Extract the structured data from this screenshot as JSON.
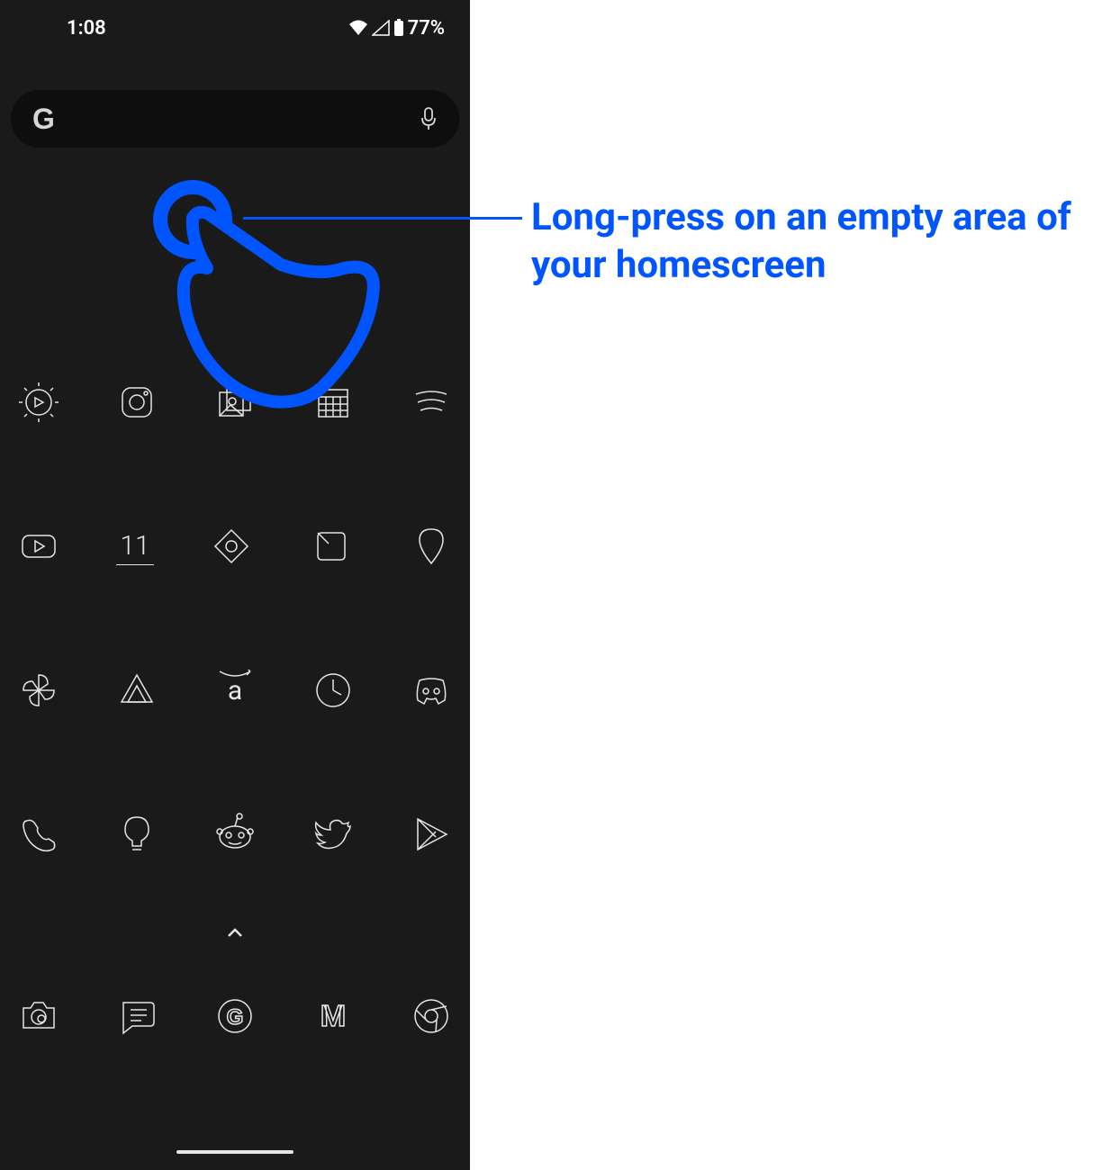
{
  "statusbar": {
    "time": "1:08",
    "battery": "77%"
  },
  "search": {
    "logo": "G"
  },
  "rows": [
    [
      "youtube-studio-icon",
      "instagram-icon",
      "gallery-icon",
      "calendar-icon",
      "spotify-icon"
    ],
    [
      "youtube-icon",
      "eleven-icon",
      "diamond-icon",
      "file-icon",
      "location-icon"
    ],
    [
      "photos-icon",
      "drive-icon",
      "amazon-icon",
      "clock-icon",
      "discord-icon"
    ],
    [
      "phone-icon",
      "keep-icon",
      "reddit-icon",
      "twitter-icon",
      "play-store-icon"
    ]
  ],
  "dock": [
    "camera-icon",
    "messages-icon",
    "google-icon",
    "gmail-icon",
    "chrome-icon"
  ],
  "chevron": "^",
  "annotation": {
    "text": "Long-press on an empty area of your homescreen"
  },
  "icon_labels": {
    "eleven": "11",
    "amazon": "a",
    "google": "G",
    "gmail": "M"
  }
}
